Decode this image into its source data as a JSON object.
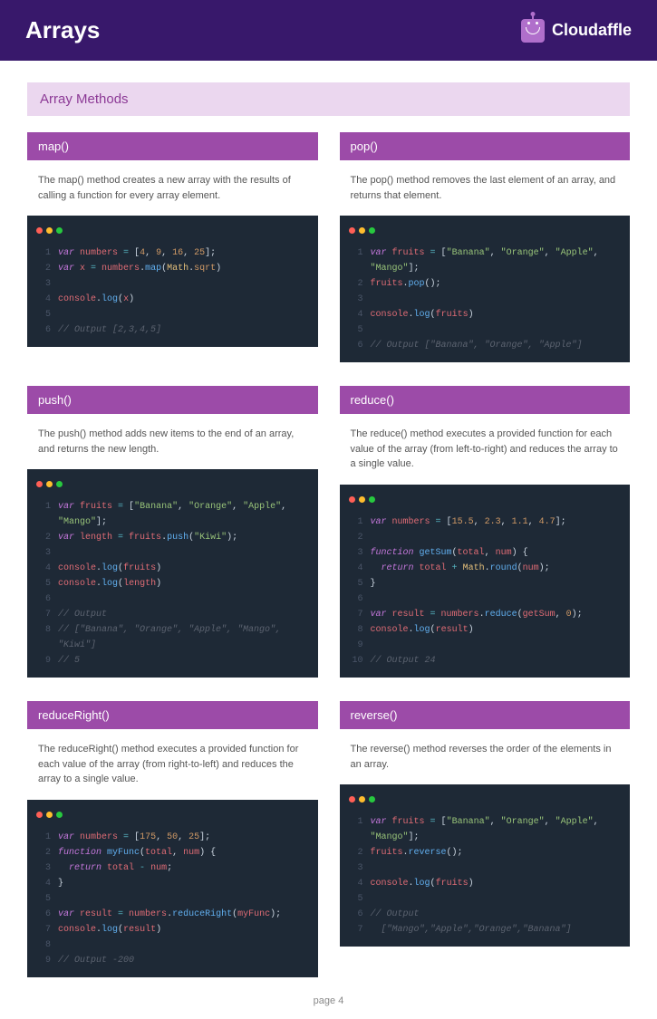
{
  "header": {
    "title": "Arrays",
    "brand": "Cloudaffle"
  },
  "section": {
    "title": "Array Methods"
  },
  "footer": {
    "text": "page 4"
  },
  "methods": [
    {
      "name": "map()",
      "desc": "The map() method creates a new array with the results of calling a function for every array element."
    },
    {
      "name": "pop()",
      "desc": "The pop() method removes the last element of an array, and returns that element."
    },
    {
      "name": "push()",
      "desc": "The push() method adds new items to the end of an array, and returns the new length."
    },
    {
      "name": "reduce()",
      "desc": "The reduce() method executes a provided function for each value of the array (from left-to-right) and reduces the array to a single value."
    },
    {
      "name": "reduceRight()",
      "desc": "The reduceRight() method executes a provided function for each value of the array (from right-to-left) and reduces the array to a single value."
    },
    {
      "name": "reverse()",
      "desc": "The reverse() method reverses the order of the elements in an array."
    }
  ],
  "code": {
    "map": [
      [
        [
          "kw",
          "var "
        ],
        [
          "var",
          "numbers"
        ],
        [
          "op",
          " = "
        ],
        [
          "",
          "["
        ],
        [
          "num",
          "4"
        ],
        [
          "",
          ", "
        ],
        [
          "num",
          "9"
        ],
        [
          "",
          ", "
        ],
        [
          "num",
          "16"
        ],
        [
          "",
          ", "
        ],
        [
          "num",
          "25"
        ],
        [
          "",
          "];"
        ]
      ],
      [
        [
          "kw",
          "var "
        ],
        [
          "var",
          "x"
        ],
        [
          "op",
          " = "
        ],
        [
          "var",
          "numbers"
        ],
        [
          "",
          "."
        ],
        [
          "fn",
          "map"
        ],
        [
          "",
          "("
        ],
        [
          "cls",
          "Math"
        ],
        [
          "",
          "."
        ],
        [
          "prop",
          "sqrt"
        ],
        [
          "",
          ")"
        ]
      ],
      [],
      [
        [
          "var",
          "console"
        ],
        [
          "",
          "."
        ],
        [
          "fn",
          "log"
        ],
        [
          "",
          "("
        ],
        [
          "var",
          "x"
        ],
        [
          "",
          ")"
        ]
      ],
      [],
      [
        [
          "cm",
          "// Output [2,3,4,5]"
        ]
      ]
    ],
    "pop": [
      [
        [
          "kw",
          "var "
        ],
        [
          "var",
          "fruits"
        ],
        [
          "op",
          " = "
        ],
        [
          "",
          "["
        ],
        [
          "str",
          "\"Banana\""
        ],
        [
          "",
          ", "
        ],
        [
          "str",
          "\"Orange\""
        ],
        [
          "",
          ", "
        ],
        [
          "str",
          "\"Apple\""
        ],
        [
          "",
          ", "
        ],
        [
          "str",
          "\"Mango\""
        ],
        [
          "",
          "];"
        ]
      ],
      [
        [
          "var",
          "fruits"
        ],
        [
          "",
          "."
        ],
        [
          "fn",
          "pop"
        ],
        [
          "",
          "();"
        ]
      ],
      [],
      [
        [
          "var",
          "console"
        ],
        [
          "",
          "."
        ],
        [
          "fn",
          "log"
        ],
        [
          "",
          "("
        ],
        [
          "var",
          "fruits"
        ],
        [
          "",
          ")"
        ]
      ],
      [],
      [
        [
          "cm",
          "// Output [\"Banana\", \"Orange\", \"Apple\"]"
        ]
      ]
    ],
    "push": [
      [
        [
          "kw",
          "var "
        ],
        [
          "var",
          "fruits"
        ],
        [
          "op",
          " = "
        ],
        [
          "",
          "["
        ],
        [
          "str",
          "\"Banana\""
        ],
        [
          "",
          ", "
        ],
        [
          "str",
          "\"Orange\""
        ],
        [
          "",
          ", "
        ],
        [
          "str",
          "\"Apple\""
        ],
        [
          "",
          ", "
        ],
        [
          "str",
          "\"Mango\""
        ],
        [
          "",
          "];"
        ]
      ],
      [
        [
          "kw",
          "var "
        ],
        [
          "var",
          "length"
        ],
        [
          "op",
          " = "
        ],
        [
          "var",
          "fruits"
        ],
        [
          "",
          "."
        ],
        [
          "fn",
          "push"
        ],
        [
          "",
          "("
        ],
        [
          "str",
          "\"Kiwi\""
        ],
        [
          "",
          ");"
        ]
      ],
      [],
      [
        [
          "var",
          "console"
        ],
        [
          "",
          "."
        ],
        [
          "fn",
          "log"
        ],
        [
          "",
          "("
        ],
        [
          "var",
          "fruits"
        ],
        [
          "",
          ")"
        ]
      ],
      [
        [
          "var",
          "console"
        ],
        [
          "",
          "."
        ],
        [
          "fn",
          "log"
        ],
        [
          "",
          "("
        ],
        [
          "var",
          "length"
        ],
        [
          "",
          ")"
        ]
      ],
      [],
      [
        [
          "cm",
          "// Output"
        ]
      ],
      [
        [
          "cm",
          "// [\"Banana\", \"Orange\", \"Apple\", \"Mango\", \"Kiwi\"]"
        ]
      ],
      [
        [
          "cm",
          "// 5"
        ]
      ]
    ],
    "reduce": [
      [
        [
          "kw",
          "var "
        ],
        [
          "var",
          "numbers"
        ],
        [
          "op",
          " = "
        ],
        [
          "",
          "["
        ],
        [
          "num",
          "15.5"
        ],
        [
          "",
          ", "
        ],
        [
          "num",
          "2.3"
        ],
        [
          "",
          ", "
        ],
        [
          "num",
          "1.1"
        ],
        [
          "",
          ", "
        ],
        [
          "num",
          "4.7"
        ],
        [
          "",
          "];"
        ]
      ],
      [],
      [
        [
          "kw",
          "function "
        ],
        [
          "fn",
          "getSum"
        ],
        [
          "",
          "("
        ],
        [
          "var",
          "total"
        ],
        [
          "",
          ", "
        ],
        [
          "var",
          "num"
        ],
        [
          "",
          ") {"
        ]
      ],
      [
        [
          "",
          "  "
        ],
        [
          "kw",
          "return "
        ],
        [
          "var",
          "total"
        ],
        [
          "op",
          " + "
        ],
        [
          "cls",
          "Math"
        ],
        [
          "",
          "."
        ],
        [
          "fn",
          "round"
        ],
        [
          "",
          "("
        ],
        [
          "var",
          "num"
        ],
        [
          "",
          ");"
        ]
      ],
      [
        [
          "",
          "}"
        ]
      ],
      [],
      [
        [
          "kw",
          "var "
        ],
        [
          "var",
          "result"
        ],
        [
          "op",
          " = "
        ],
        [
          "var",
          "numbers"
        ],
        [
          "",
          "."
        ],
        [
          "fn",
          "reduce"
        ],
        [
          "",
          "("
        ],
        [
          "var",
          "getSum"
        ],
        [
          "",
          ", "
        ],
        [
          "num",
          "0"
        ],
        [
          "",
          ");"
        ]
      ],
      [
        [
          "var",
          "console"
        ],
        [
          "",
          "."
        ],
        [
          "fn",
          "log"
        ],
        [
          "",
          "("
        ],
        [
          "var",
          "result"
        ],
        [
          "",
          ")"
        ]
      ],
      [],
      [
        [
          "cm",
          "// Output 24"
        ]
      ]
    ],
    "reduceRight": [
      [
        [
          "kw",
          "var "
        ],
        [
          "var",
          "numbers"
        ],
        [
          "op",
          " = "
        ],
        [
          "",
          "["
        ],
        [
          "num",
          "175"
        ],
        [
          "",
          ", "
        ],
        [
          "num",
          "50"
        ],
        [
          "",
          ", "
        ],
        [
          "num",
          "25"
        ],
        [
          "",
          "];"
        ]
      ],
      [
        [
          "kw",
          "function "
        ],
        [
          "fn",
          "myFunc"
        ],
        [
          "",
          "("
        ],
        [
          "var",
          "total"
        ],
        [
          "",
          ", "
        ],
        [
          "var",
          "num"
        ],
        [
          "",
          ") {"
        ]
      ],
      [
        [
          "",
          "  "
        ],
        [
          "kw",
          "return "
        ],
        [
          "var",
          "total"
        ],
        [
          "op",
          " - "
        ],
        [
          "var",
          "num"
        ],
        [
          "",
          ";"
        ]
      ],
      [
        [
          "",
          "}"
        ]
      ],
      [],
      [
        [
          "kw",
          "var "
        ],
        [
          "var",
          "result"
        ],
        [
          "op",
          " = "
        ],
        [
          "var",
          "numbers"
        ],
        [
          "",
          "."
        ],
        [
          "fn",
          "reduceRight"
        ],
        [
          "",
          "("
        ],
        [
          "var",
          "myFunc"
        ],
        [
          "",
          ");"
        ]
      ],
      [
        [
          "var",
          "console"
        ],
        [
          "",
          "."
        ],
        [
          "fn",
          "log"
        ],
        [
          "",
          "("
        ],
        [
          "var",
          "result"
        ],
        [
          "",
          ")"
        ]
      ],
      [],
      [
        [
          "cm",
          "// Output -200"
        ]
      ]
    ],
    "reverse": [
      [
        [
          "kw",
          "var "
        ],
        [
          "var",
          "fruits"
        ],
        [
          "op",
          " = "
        ],
        [
          "",
          "["
        ],
        [
          "str",
          "\"Banana\""
        ],
        [
          "",
          ", "
        ],
        [
          "str",
          "\"Orange\""
        ],
        [
          "",
          ", "
        ],
        [
          "str",
          "\"Apple\""
        ],
        [
          "",
          ", "
        ],
        [
          "str",
          "\"Mango\""
        ],
        [
          "",
          "];"
        ]
      ],
      [
        [
          "var",
          "fruits"
        ],
        [
          "",
          "."
        ],
        [
          "fn",
          "reverse"
        ],
        [
          "",
          "();"
        ]
      ],
      [],
      [
        [
          "var",
          "console"
        ],
        [
          "",
          "."
        ],
        [
          "fn",
          "log"
        ],
        [
          "",
          "("
        ],
        [
          "var",
          "fruits"
        ],
        [
          "",
          ")"
        ]
      ],
      [],
      [
        [
          "cm",
          "// Output"
        ]
      ],
      [
        [
          "cm",
          "  [\"Mango\",\"Apple\",\"Orange\",\"Banana\"]"
        ]
      ]
    ]
  },
  "codeOrder": [
    "map",
    "pop",
    "push",
    "reduce",
    "reduceRight",
    "reverse"
  ]
}
